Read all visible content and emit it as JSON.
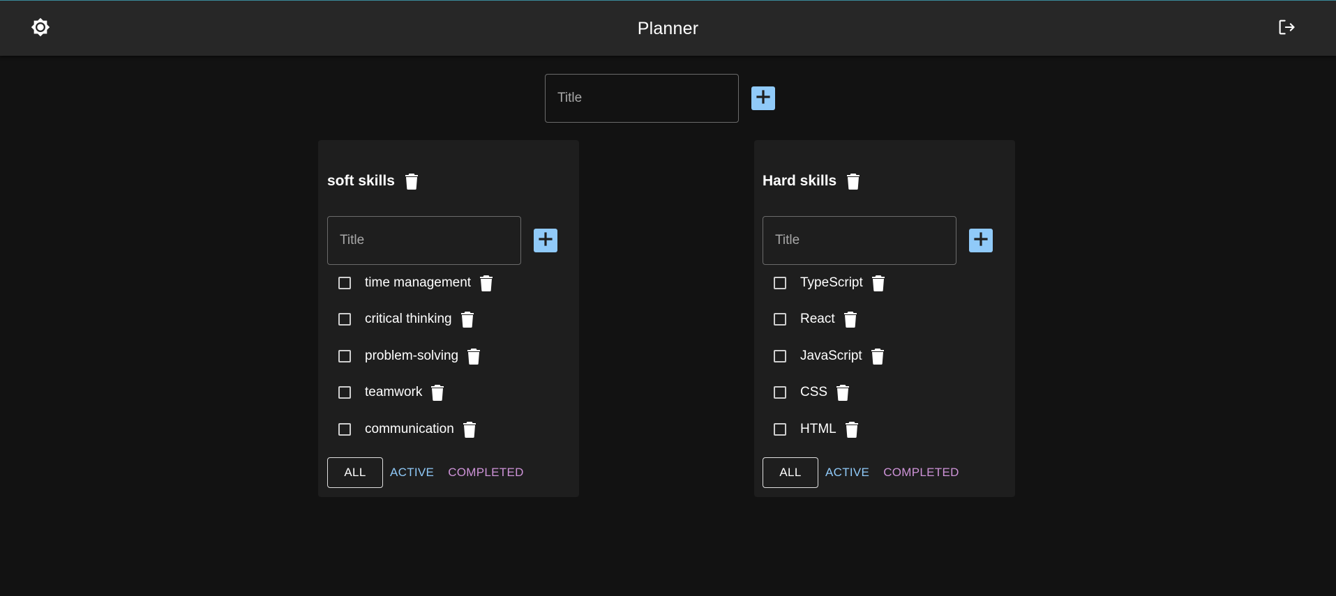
{
  "header": {
    "title": "Planner",
    "theme_icon": "brightness-icon",
    "logout_icon": "logout-icon"
  },
  "new_list": {
    "placeholder": "Title",
    "add_icon": "plus-icon"
  },
  "colors": {
    "background": "#121212",
    "appbar": "#272727",
    "card": "#1e1e1e",
    "primary": "#90caf9",
    "secondary": "#ce93d8"
  },
  "lists": [
    {
      "title": "soft skills",
      "input_placeholder": "Title",
      "tasks": [
        {
          "label": "time management",
          "checked": false
        },
        {
          "label": "critical thinking",
          "checked": false
        },
        {
          "label": "problem-solving",
          "checked": false
        },
        {
          "label": "teamwork",
          "checked": false
        },
        {
          "label": "communication",
          "checked": false
        }
      ],
      "filters": {
        "all": "ALL",
        "active": "ACTIVE",
        "completed": "COMPLETED",
        "selected": "ALL"
      }
    },
    {
      "title": "Hard skills",
      "input_placeholder": "Title",
      "tasks": [
        {
          "label": "TypeScript",
          "checked": false
        },
        {
          "label": "React",
          "checked": false
        },
        {
          "label": "JavaScript",
          "checked": false
        },
        {
          "label": "CSS",
          "checked": false
        },
        {
          "label": "HTML",
          "checked": false
        }
      ],
      "filters": {
        "all": "ALL",
        "active": "ACTIVE",
        "completed": "COMPLETED",
        "selected": "ALL"
      }
    }
  ]
}
